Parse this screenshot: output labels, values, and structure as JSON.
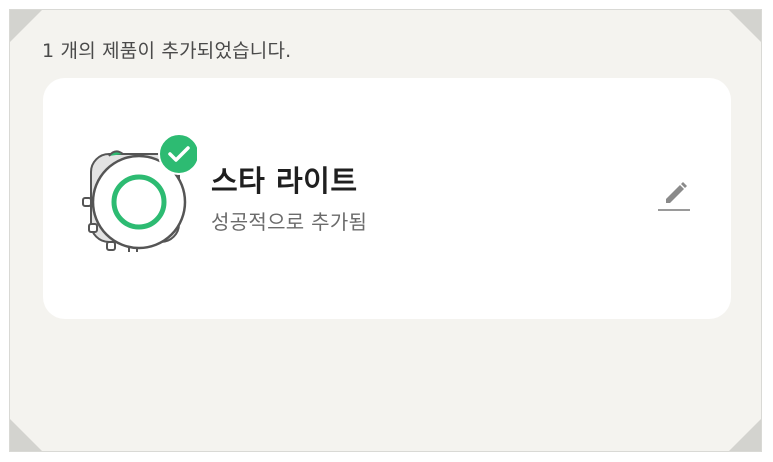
{
  "header": {
    "message": "1 개의 제품이 추가되었습니다."
  },
  "product": {
    "name": "스타 라이트",
    "status": "성공적으로 추가됨",
    "icon": "star-light-device-icon",
    "check_icon": "checkmark-icon"
  },
  "actions": {
    "edit_icon": "pencil-icon"
  },
  "colors": {
    "background": "#f4f3ef",
    "card": "#ffffff",
    "accent_green": "#2dbb72",
    "edit_icon": "#8a8a8a"
  }
}
